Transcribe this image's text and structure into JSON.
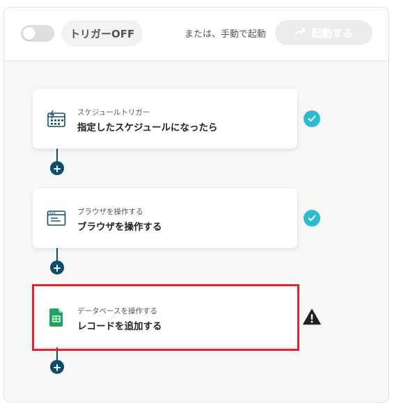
{
  "header": {
    "trigger_label": "トリガーOFF",
    "or_text": "または、手動で起動",
    "start_button_label": "起動する"
  },
  "steps": [
    {
      "subtitle": "スケジュールトリガー",
      "title": "指定したスケジュールになったら",
      "icon": "calendar-schedule-icon",
      "status": "check"
    },
    {
      "subtitle": "ブラウザを操作する",
      "title": "ブラウザを操作する",
      "icon": "browser-window-icon",
      "status": "check"
    },
    {
      "subtitle": "データベースを操作する",
      "title": "レコードを追加する",
      "icon": "google-sheets-icon",
      "status": "warning"
    }
  ],
  "colors": {
    "connector": "#0b4d6b",
    "check": "#2bbccf",
    "highlight": "#e0252b",
    "sheets_green": "#1fa463"
  }
}
